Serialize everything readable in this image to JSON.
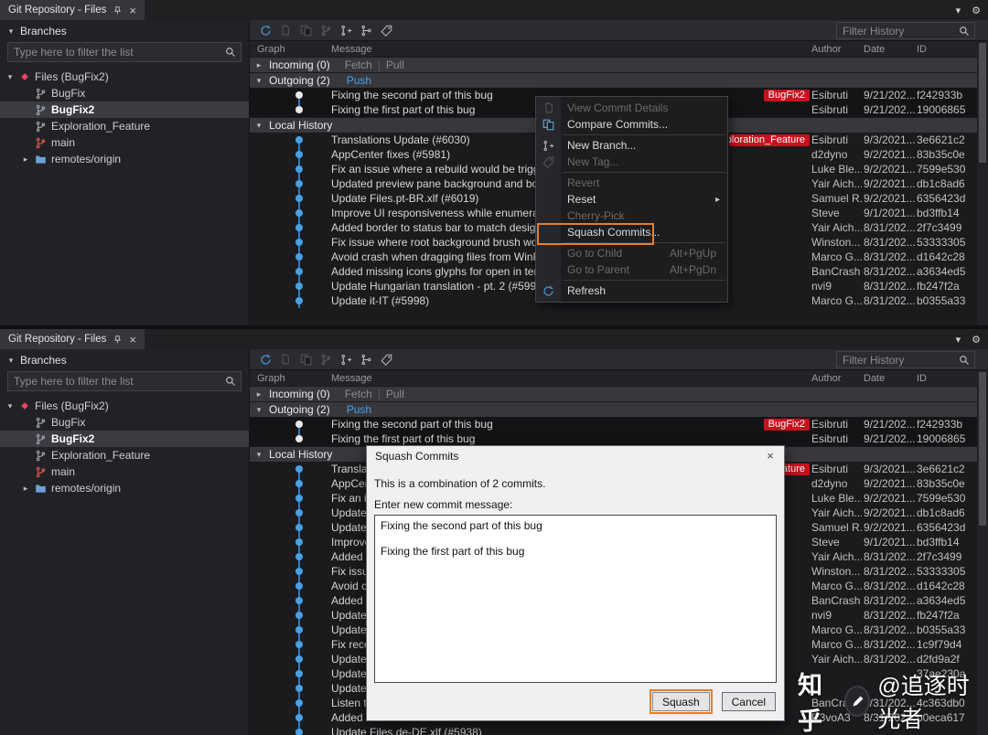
{
  "tab": {
    "title": "Git Repository - Files"
  },
  "icons": {
    "close": "×",
    "gear": "⚙",
    "chevron_down": "▾",
    "expanded": "▾",
    "collapsed": "▸",
    "submenu": "▸"
  },
  "sidebar": {
    "header": "Branches",
    "filter_placeholder": "Type here to filter the list",
    "tree": [
      {
        "label": "Files (BugFix2)",
        "icon": "files-logo",
        "expander": "▾",
        "level": 0
      },
      {
        "label": "BugFix",
        "icon": "branch",
        "level": 1
      },
      {
        "label": "BugFix2",
        "icon": "branch",
        "level": 1,
        "selected": true,
        "bold": true
      },
      {
        "label": "Exploration_Feature",
        "icon": "branch",
        "level": 1
      },
      {
        "label": "main",
        "icon": "branch-red",
        "level": 1
      },
      {
        "label": "remotes/origin",
        "icon": "folder",
        "expander": "▸",
        "level": 1
      }
    ]
  },
  "history": {
    "filter_placeholder": "Filter History",
    "columns": {
      "graph": "Graph",
      "message": "Message",
      "author": "Author",
      "date": "Date",
      "id": "ID"
    },
    "incoming_label": "Incoming (0)",
    "fetch_label": "Fetch",
    "link_divider": "|",
    "pull_label": "Pull",
    "outgoing_label": "Outgoing (2)",
    "push_label": "Push",
    "local_history_label": "Local History",
    "toolbar": [
      {
        "name": "refresh",
        "kind": "refresh"
      },
      {
        "name": "commit-details",
        "kind": "doc",
        "disabled": true
      },
      {
        "name": "compare-commits",
        "kind": "docs",
        "disabled": true
      },
      {
        "name": "browse-branch",
        "kind": "branch",
        "disabled": true
      },
      {
        "name": "new-branch",
        "kind": "branch-plus"
      },
      {
        "name": "merge",
        "kind": "merge"
      },
      {
        "name": "new-tag",
        "kind": "tag"
      }
    ],
    "outgoing_commits": [
      {
        "message": "Fixing the second part of this bug",
        "badge": "BugFix2",
        "author": "Esibruti",
        "date": "9/21/202...",
        "id": "f242933b"
      },
      {
        "message": "Fixing the first part of this bug",
        "author": "Esibruti",
        "date": "9/21/202...",
        "id": "19006865"
      }
    ]
  },
  "panels": {
    "top": {
      "local_commits": [
        {
          "message": "Translations Update (#6030)",
          "badge": "Exploration_Feature",
          "author": "Esibruti",
          "date": "9/3/2021...",
          "id": "3e6621c2"
        },
        {
          "message": "AppCenter fixes (#5981)",
          "author": "d2dyno",
          "date": "9/2/2021...",
          "id": "83b35c0e"
        },
        {
          "message": "Fix an issue where a rebuild would be triggered o",
          "author": "Luke Ble...",
          "date": "9/2/2021...",
          "id": "7599e530"
        },
        {
          "message": "Updated preview pane background and border (#",
          "author": "Yair Aich...",
          "date": "9/2/2021...",
          "id": "db1c8ad6"
        },
        {
          "message": "Update Files.pt-BR.xlf (#6019)",
          "author": "Samuel R...",
          "date": "9/2/2021...",
          "id": "6356423d"
        },
        {
          "message": "Improve UI responsiveness while enumerating (#5",
          "author": "Steve",
          "date": "9/1/2021...",
          "id": "bd3ffb14"
        },
        {
          "message": "Added border to status bar to match design spec",
          "author": "Yair Aich...",
          "date": "8/31/202...",
          "id": "2f7c3499"
        },
        {
          "message": "Fix issue where root background brush wouldn't s",
          "author": "Winston...",
          "date": "8/31/202...",
          "id": "53333305"
        },
        {
          "message": "Avoid crash when dragging files from WinRAR (#",
          "author": "Marco G...",
          "date": "8/31/202...",
          "id": "d1642c28"
        },
        {
          "message": "Added missing icons glyphs for open in terminal a",
          "author": "BanCrash",
          "date": "8/31/202...",
          "id": "a3634ed5"
        },
        {
          "message": "Update Hungarian translation - pt. 2 (#5996)",
          "author": "nvi9",
          "date": "8/31/202...",
          "id": "fb247f2a"
        },
        {
          "message": "Update it-IT (#5998)",
          "author": "Marco G...",
          "date": "8/31/202...",
          "id": "b0355a33"
        }
      ]
    },
    "bottom": {
      "local_commits": [
        {
          "message": "Translations Update (#6030)",
          "badge": "Exploration_Feature",
          "author": "Esibruti",
          "date": "9/3/2021...",
          "id": "3e6621c2"
        },
        {
          "message": "AppCenter fixes (#5981)",
          "author": "d2dyno",
          "date": "9/2/2021...",
          "id": "83b35c0e"
        },
        {
          "message": "Fix an issue where a rebuild would be triggered o",
          "author": "Luke Ble...",
          "date": "9/2/2021...",
          "id": "7599e530"
        },
        {
          "message": "Updated preview pane background and border (#",
          "author": "Yair Aich...",
          "date": "9/2/2021...",
          "id": "db1c8ad6"
        },
        {
          "message": "Update Files.pt-BR.xlf (#6019)",
          "author": "Samuel R...",
          "date": "9/2/2021...",
          "id": "6356423d"
        },
        {
          "message": "Improve UI responsiveness while enumerating (#5",
          "author": "Steve",
          "date": "9/1/2021...",
          "id": "bd3ffb14"
        },
        {
          "message": "Added border to status bar to match design spec",
          "author": "Yair Aich...",
          "date": "8/31/202...",
          "id": "2f7c3499"
        },
        {
          "message": "Fix issue where root background brush wouldn't s",
          "author": "Winston...",
          "date": "8/31/202...",
          "id": "53333305"
        },
        {
          "message": "Avoid crash when dragging files from WinRAR (#",
          "author": "Marco G...",
          "date": "8/31/202...",
          "id": "d1642c28"
        },
        {
          "message": "Added missing icons glyphs for open in terminal a",
          "author": "BanCrash",
          "date": "8/31/202...",
          "id": "a3634ed5"
        },
        {
          "message": "Update Hungarian translation - pt. 2 (#5996)",
          "author": "nvi9",
          "date": "8/31/202...",
          "id": "fb247f2a"
        },
        {
          "message": "Update it-IT (#5998)",
          "author": "Marco G...",
          "date": "8/31/202...",
          "id": "b0355a33"
        },
        {
          "message": "Fix recen",
          "author": "Marco G...",
          "date": "8/31/202...",
          "id": "1c9f79d4"
        },
        {
          "message": "Updated",
          "author": "Yair Aich...",
          "date": "8/31/202...",
          "id": "d2fd9a2f"
        },
        {
          "message": "Update",
          "author": "",
          "date": "",
          "id": "37ae230a"
        },
        {
          "message": "Update F",
          "author": "",
          "date": "",
          "id": ""
        },
        {
          "message": "Listen to",
          "author": "BanCrash",
          "date": "8/31/202...",
          "id": "4c363db0"
        },
        {
          "message": "Added c",
          "author": "R3voA3",
          "date": "8/31/202...",
          "id": "b0eca617"
        },
        {
          "message": "Update Files.de-DE.xlf (#5938)",
          "author": "",
          "date": "",
          "id": ""
        }
      ]
    }
  },
  "context_menu": {
    "items": [
      {
        "label": "View Commit Details",
        "icon": "view-details",
        "kind": "doc",
        "disabled": true
      },
      {
        "label": "Compare Commits...",
        "icon": "compare-commits",
        "kind": "docs"
      },
      {
        "separator": true
      },
      {
        "label": "New Branch...",
        "icon": "new-branch",
        "kind": "branch-plus"
      },
      {
        "label": "New Tag...",
        "icon": "new-tag",
        "kind": "tag",
        "disabled": true
      },
      {
        "separator": true
      },
      {
        "label": "Revert",
        "disabled": true
      },
      {
        "label": "Reset",
        "submenu": true
      },
      {
        "label": "Cherry-Pick",
        "disabled": true
      },
      {
        "label": "Squash Commits...",
        "annotated": true
      },
      {
        "separator": true
      },
      {
        "label": "Go to Child",
        "shortcut": "Alt+PgUp",
        "disabled": true
      },
      {
        "label": "Go to Parent",
        "shortcut": "Alt+PgDn",
        "disabled": true
      },
      {
        "separator": true
      },
      {
        "label": "Refresh",
        "icon": "refresh",
        "kind": "refresh"
      }
    ]
  },
  "dialog": {
    "title": "Squash Commits",
    "intro": "This is a combination of 2 commits.",
    "prompt": "Enter new commit message:",
    "message": "Fixing the second part of this bug\n\nFixing the first part of this bug",
    "squash_label": "Squash",
    "cancel_label": "Cancel"
  },
  "watermark": {
    "prefix": "知乎",
    "handle": "@追逐时光者"
  }
}
